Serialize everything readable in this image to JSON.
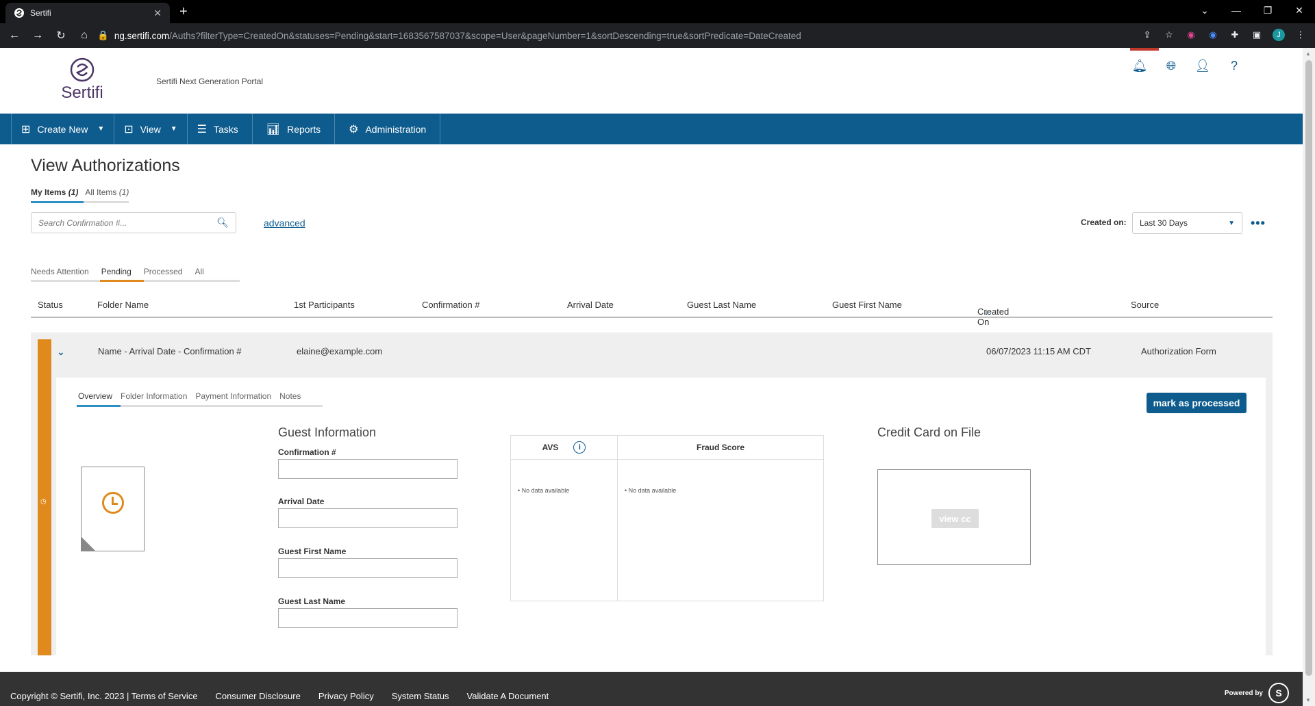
{
  "browser": {
    "tab_title": "Sertifi",
    "url_host": "ng.sertifi.com",
    "url_path": "/Auths?filterType=CreatedOn&statuses=Pending&start=1683567587037&scope=User&pageNumber=1&sortDescending=true&sortPredicate=DateCreated",
    "profile_initial": "J"
  },
  "header": {
    "logo_text": "Sertifi",
    "portal_title": "Sertifi Next Generation Portal"
  },
  "nav": {
    "create_new": "Create New",
    "view": "View",
    "tasks": "Tasks",
    "reports": "Reports",
    "administration": "Administration"
  },
  "page": {
    "title": "View Authorizations",
    "scope_tabs": {
      "my_items_label": "My Items",
      "my_items_count": "(1)",
      "all_items_label": "All Items",
      "all_items_count": "(1)"
    },
    "search_placeholder": "Search Confirmation #...",
    "advanced_link": "advanced",
    "created_on_label": "Created on:",
    "created_on_value": "Last 30 Days",
    "status_tabs": [
      "Needs Attention",
      "Pending",
      "Processed",
      "All"
    ]
  },
  "table": {
    "headers": {
      "status": "Status",
      "folder_name": "Folder Name",
      "participants": "1st Participants",
      "confirmation": "Confirmation #",
      "arrival_date": "Arrival Date",
      "guest_last_name": "Guest Last Name",
      "guest_first_name": "Guest First Name",
      "created_on": "Created On",
      "source": "Source"
    },
    "row": {
      "folder_name": "Name - Arrival Date - Confirmation #",
      "participant": "elaine@example.com",
      "created_on": "06/07/2023 11:15 AM CDT",
      "source": "Authorization Form"
    }
  },
  "detail": {
    "tabs": [
      "Overview",
      "Folder Information",
      "Payment Information",
      "Notes"
    ],
    "mark_button": "mark as processed",
    "guest_title": "Guest Information",
    "fields": {
      "confirmation": "Confirmation #",
      "arrival_date": "Arrival Date",
      "guest_first_name": "Guest First Name",
      "guest_last_name": "Guest Last Name"
    },
    "avs_header": "AVS",
    "fraud_header": "Fraud Score",
    "avs_no_data": "• No data available",
    "fraud_no_data": "• No data available",
    "cc_title": "Credit Card on File",
    "view_cc": "view cc"
  },
  "footer": {
    "copyright": "Copyright © Sertifi, Inc. 2023 | Terms of Service",
    "consumer_disclosure": "Consumer Disclosure",
    "privacy_policy": "Privacy Policy",
    "system_status": "System Status",
    "validate": "Validate A Document",
    "powered_by": "Powered by"
  },
  "colors": {
    "nav_blue": "#0e5c8e",
    "pending_orange": "#e08a1e",
    "footer_bg": "#333333"
  }
}
